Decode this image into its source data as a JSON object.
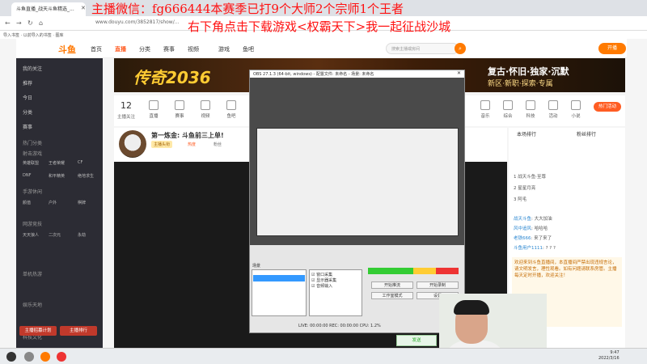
{
  "browser": {
    "tab_title": "斗鱼直播_战天斗鱼精选_...",
    "url": "www.douyu.com/3852817/show/...",
    "bookmarks": "导入书签   ·   以前导入的书签   ·   图库"
  },
  "site": {
    "logo": "斗鱼",
    "nav": [
      "首页",
      "直播",
      "分类",
      "赛事",
      "视频",
      "游戏",
      "鱼吧"
    ],
    "search_placeholder": "搜索主播或房间",
    "open_label": "开播"
  },
  "sidebar": {
    "items": [
      "我的关注",
      "推荐",
      "今日",
      "分类",
      "赛事"
    ],
    "sections": [
      "热门分类",
      "射击游戏",
      "手游休闲",
      "网游竞技",
      "单机热游",
      "娱乐天地",
      "科技文化"
    ],
    "grid": [
      "英雄联盟",
      "王者荣耀",
      "CF",
      "DNF",
      "和平精英",
      "绝地求生",
      "颜值",
      "户外",
      "棋牌",
      "天天狼人",
      "二次元",
      "永劫"
    ],
    "btn_left": "主播招募计划",
    "btn_right": "主播排行"
  },
  "banner": {
    "game": "传奇2036",
    "slogan1": "复古·怀旧·独家·沉默",
    "slogan2": "新区·新职·探索·专属"
  },
  "categories": {
    "follow_count": "12",
    "follow_label": "主播关注",
    "items": [
      "直播",
      "赛事",
      "视频",
      "鱼吧",
      "游戏",
      "音乐",
      "综合",
      "科技",
      "活动",
      "小说",
      "关注",
      "更多"
    ],
    "hot_label": "热门活动"
  },
  "room": {
    "title": "第一炼金: 斗鱼前三上单!",
    "tag1": "主播头衔",
    "tag2": "热度",
    "tag3": "粉丝"
  },
  "obs": {
    "title": "OBS 27.1.3 (64-bit, windows) - 配置文件: 未命名 - 场景: 未命名",
    "scenes_label": "场景",
    "source1": "窗口采集",
    "source2": "显示器采集",
    "source3": "音频输入",
    "btn1": "开始推流",
    "btn2": "开始录制",
    "btn3": "工作室模式",
    "btn4": "设置",
    "status": "LIVE: 00:00:00  REC: 00:00:00  CPU: 1.2%"
  },
  "chat": {
    "tab_left": "本场排行",
    "tab_right": "粉丝排行",
    "rows": [
      "1  战天斗鱼·至尊",
      "2  星星月亮",
      "3  阿毛"
    ],
    "lines": [
      {
        "nick": "战天斗鱼",
        "text": "大大加油"
      },
      {
        "nick": "风中追风",
        "text": "哈哈哈"
      },
      {
        "nick": "老铁666",
        "text": "来了来了"
      },
      {
        "nick": "斗鱼用户1111",
        "text": "? ? ?"
      }
    ],
    "notice": "欢迎来到斗鱼直播间，本直播间严禁出现违规言论，请文明发言，理性观看。如有问题请联系房管。主播每天定时开播，欢迎关注！",
    "send_label": "发送"
  },
  "overlay": {
    "line1": "主播微信：fg666444本赛季已打9个大师2个宗师1个王者",
    "line2": "右下角点击下载游戏<权霸天下>我一起征战沙城"
  },
  "taskbar": {
    "time": "9:47",
    "date": "2022/3/16"
  }
}
